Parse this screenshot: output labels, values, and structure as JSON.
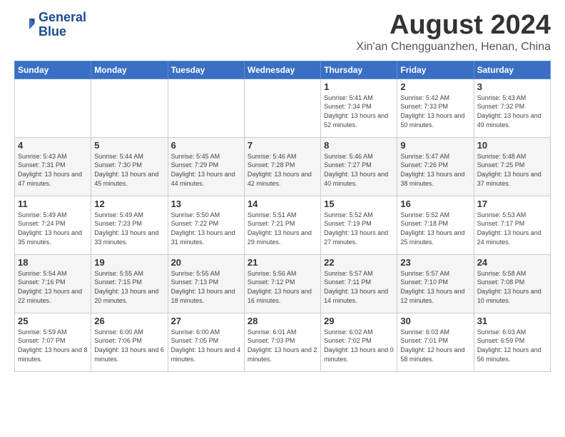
{
  "header": {
    "logo_line1": "General",
    "logo_line2": "Blue",
    "month_title": "August 2024",
    "location": "Xin'an Chengguanzhen, Henan, China"
  },
  "weekdays": [
    "Sunday",
    "Monday",
    "Tuesday",
    "Wednesday",
    "Thursday",
    "Friday",
    "Saturday"
  ],
  "weeks": [
    [
      {
        "day": "",
        "info": ""
      },
      {
        "day": "",
        "info": ""
      },
      {
        "day": "",
        "info": ""
      },
      {
        "day": "",
        "info": ""
      },
      {
        "day": "1",
        "info": "Sunrise: 5:41 AM\nSunset: 7:34 PM\nDaylight: 13 hours\nand 52 minutes."
      },
      {
        "day": "2",
        "info": "Sunrise: 5:42 AM\nSunset: 7:33 PM\nDaylight: 13 hours\nand 50 minutes."
      },
      {
        "day": "3",
        "info": "Sunrise: 5:43 AM\nSunset: 7:32 PM\nDaylight: 13 hours\nand 49 minutes."
      }
    ],
    [
      {
        "day": "4",
        "info": "Sunrise: 5:43 AM\nSunset: 7:31 PM\nDaylight: 13 hours\nand 47 minutes."
      },
      {
        "day": "5",
        "info": "Sunrise: 5:44 AM\nSunset: 7:30 PM\nDaylight: 13 hours\nand 45 minutes."
      },
      {
        "day": "6",
        "info": "Sunrise: 5:45 AM\nSunset: 7:29 PM\nDaylight: 13 hours\nand 44 minutes."
      },
      {
        "day": "7",
        "info": "Sunrise: 5:46 AM\nSunset: 7:28 PM\nDaylight: 13 hours\nand 42 minutes."
      },
      {
        "day": "8",
        "info": "Sunrise: 5:46 AM\nSunset: 7:27 PM\nDaylight: 13 hours\nand 40 minutes."
      },
      {
        "day": "9",
        "info": "Sunrise: 5:47 AM\nSunset: 7:26 PM\nDaylight: 13 hours\nand 38 minutes."
      },
      {
        "day": "10",
        "info": "Sunrise: 5:48 AM\nSunset: 7:25 PM\nDaylight: 13 hours\nand 37 minutes."
      }
    ],
    [
      {
        "day": "11",
        "info": "Sunrise: 5:49 AM\nSunset: 7:24 PM\nDaylight: 13 hours\nand 35 minutes."
      },
      {
        "day": "12",
        "info": "Sunrise: 5:49 AM\nSunset: 7:23 PM\nDaylight: 13 hours\nand 33 minutes."
      },
      {
        "day": "13",
        "info": "Sunrise: 5:50 AM\nSunset: 7:22 PM\nDaylight: 13 hours\nand 31 minutes."
      },
      {
        "day": "14",
        "info": "Sunrise: 5:51 AM\nSunset: 7:21 PM\nDaylight: 13 hours\nand 29 minutes."
      },
      {
        "day": "15",
        "info": "Sunrise: 5:52 AM\nSunset: 7:19 PM\nDaylight: 13 hours\nand 27 minutes."
      },
      {
        "day": "16",
        "info": "Sunrise: 5:52 AM\nSunset: 7:18 PM\nDaylight: 13 hours\nand 25 minutes."
      },
      {
        "day": "17",
        "info": "Sunrise: 5:53 AM\nSunset: 7:17 PM\nDaylight: 13 hours\nand 24 minutes."
      }
    ],
    [
      {
        "day": "18",
        "info": "Sunrise: 5:54 AM\nSunset: 7:16 PM\nDaylight: 13 hours\nand 22 minutes."
      },
      {
        "day": "19",
        "info": "Sunrise: 5:55 AM\nSunset: 7:15 PM\nDaylight: 13 hours\nand 20 minutes."
      },
      {
        "day": "20",
        "info": "Sunrise: 5:55 AM\nSunset: 7:13 PM\nDaylight: 13 hours\nand 18 minutes."
      },
      {
        "day": "21",
        "info": "Sunrise: 5:56 AM\nSunset: 7:12 PM\nDaylight: 13 hours\nand 16 minutes."
      },
      {
        "day": "22",
        "info": "Sunrise: 5:57 AM\nSunset: 7:11 PM\nDaylight: 13 hours\nand 14 minutes."
      },
      {
        "day": "23",
        "info": "Sunrise: 5:57 AM\nSunset: 7:10 PM\nDaylight: 13 hours\nand 12 minutes."
      },
      {
        "day": "24",
        "info": "Sunrise: 5:58 AM\nSunset: 7:08 PM\nDaylight: 13 hours\nand 10 minutes."
      }
    ],
    [
      {
        "day": "25",
        "info": "Sunrise: 5:59 AM\nSunset: 7:07 PM\nDaylight: 13 hours\nand 8 minutes."
      },
      {
        "day": "26",
        "info": "Sunrise: 6:00 AM\nSunset: 7:06 PM\nDaylight: 13 hours\nand 6 minutes."
      },
      {
        "day": "27",
        "info": "Sunrise: 6:00 AM\nSunset: 7:05 PM\nDaylight: 13 hours\nand 4 minutes."
      },
      {
        "day": "28",
        "info": "Sunrise: 6:01 AM\nSunset: 7:03 PM\nDaylight: 13 hours\nand 2 minutes."
      },
      {
        "day": "29",
        "info": "Sunrise: 6:02 AM\nSunset: 7:02 PM\nDaylight: 13 hours\nand 0 minutes."
      },
      {
        "day": "30",
        "info": "Sunrise: 6:03 AM\nSunset: 7:01 PM\nDaylight: 12 hours\nand 58 minutes."
      },
      {
        "day": "31",
        "info": "Sunrise: 6:03 AM\nSunset: 6:59 PM\nDaylight: 12 hours\nand 56 minutes."
      }
    ]
  ]
}
